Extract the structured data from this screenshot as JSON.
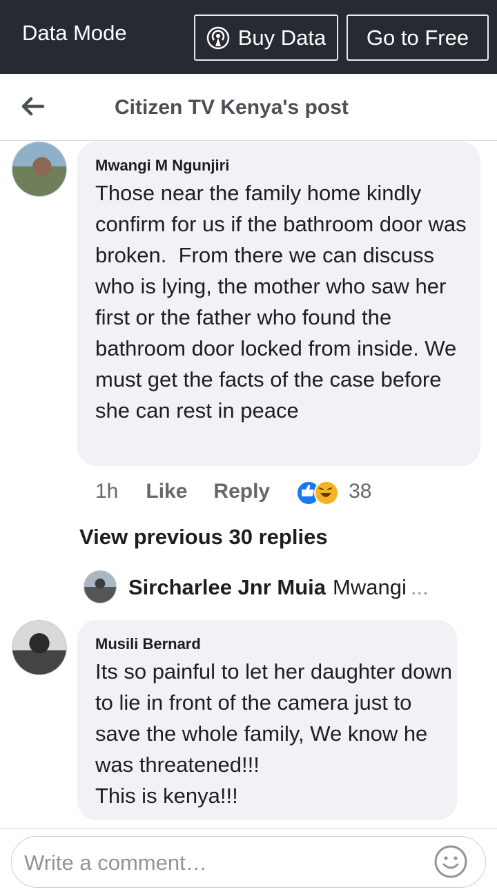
{
  "topbar": {
    "mode_label": "Data Mode",
    "buy_label": "Buy Data",
    "buy_icon": "broadcast-icon",
    "free_label": "Go to Free"
  },
  "header": {
    "back_icon": "back-arrow-icon",
    "title": "Citizen TV Kenya's post"
  },
  "comments": [
    {
      "author": "Mwangi M Ngunjiri",
      "text": "Those near the family home kindly confirm for us if the bathroom door was broken.  From there we can discuss who is lying, the mother who saw her first or the father who found the bathroom door locked from inside. We must get the facts of the case before she can rest in peace",
      "time": "1h",
      "like_label": "Like",
      "reply_label": "Reply",
      "reaction_count": "38",
      "reactions": [
        "like-icon",
        "haha-icon"
      ]
    },
    {
      "author": "Musili Bernard",
      "text": "Its so painful to let her daughter down to lie in front of the camera just to save the whole family, We know he was threatened!!!\nThis is kenya!!!"
    }
  ],
  "replies": {
    "view_previous": "View previous 30 replies",
    "preview_author": "Sircharlee Jnr Muia",
    "preview_text": "Mwangi",
    "preview_more": "..."
  },
  "composer": {
    "placeholder": "Write a comment…",
    "emoji_icon": "smiley-icon"
  },
  "colors": {
    "topbar_bg": "#262a33",
    "bubble_bg": "#f0f2f5",
    "like_blue": "#1877f2",
    "haha_yellow": "#f7b125"
  }
}
